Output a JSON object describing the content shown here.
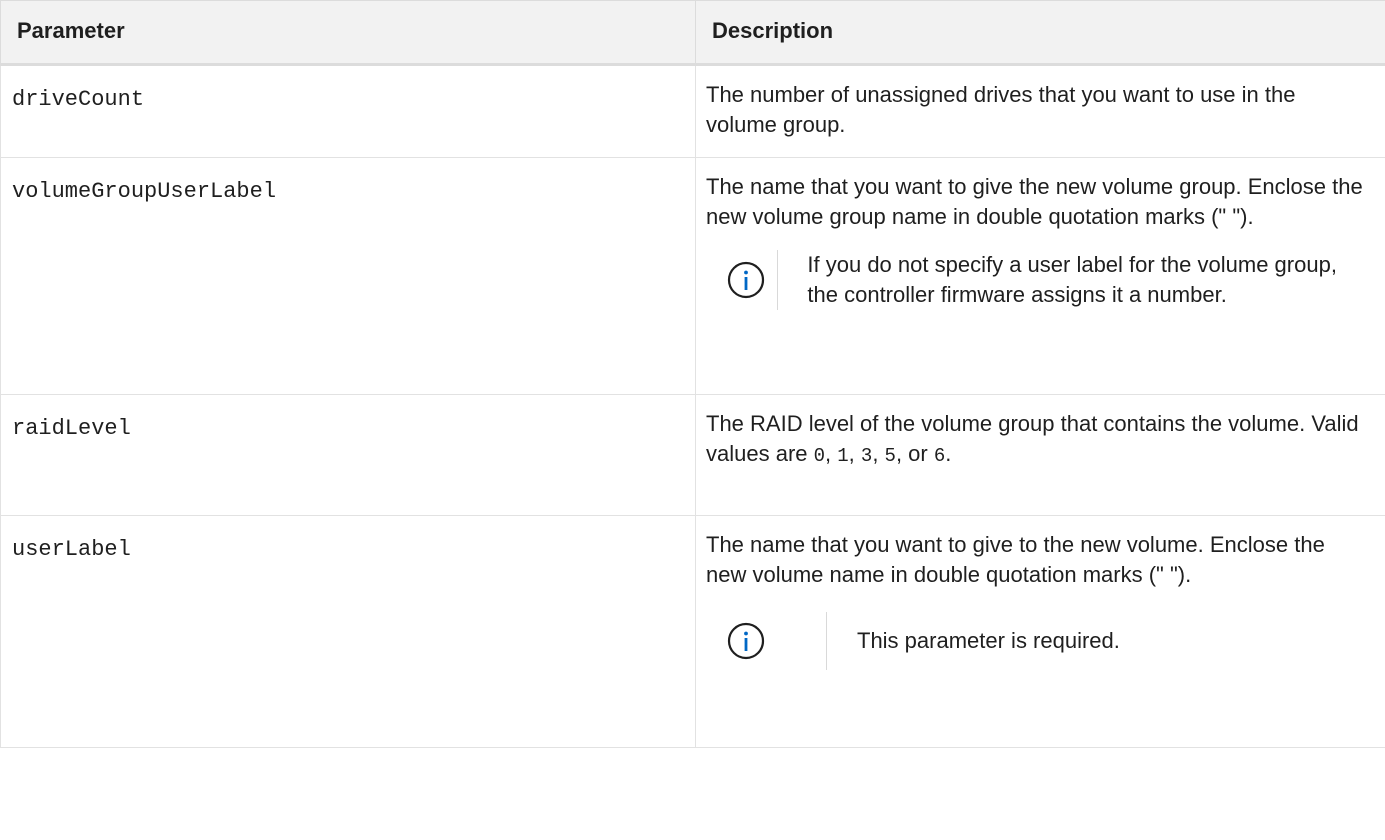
{
  "table": {
    "headers": {
      "parameter": "Parameter",
      "description": "Description"
    },
    "rows": [
      {
        "parameter": "driveCount",
        "description": "The number of unassigned drives that you want to use in the volume group."
      },
      {
        "parameter": "volumeGroupUserLabel",
        "description": "The name that you want to give the new volume group. Enclose the new volume group name in double quotation marks (\" \").",
        "note": "If you do not specify a user label for the volume group, the controller firmware assigns it a number."
      },
      {
        "parameter": "raidLevel",
        "description_prefix": "The RAID level of the volume group that contains the volume. Valid values are ",
        "values": [
          "0",
          "1",
          "3",
          "5",
          "6"
        ],
        "sep_comma": ", ",
        "sep_or": ", or ",
        "description_suffix": "."
      },
      {
        "parameter": "userLabel",
        "description": "The name that you want to give to the new volume. Enclose the new volume name in double quotation marks (\" \").",
        "note": "This parameter is required."
      }
    ]
  },
  "icons": {
    "note": "info-circle-icon"
  },
  "colors": {
    "header_bg": "#f2f2f2",
    "info_icon": "#0067c5",
    "border": "#dcdcdc"
  }
}
